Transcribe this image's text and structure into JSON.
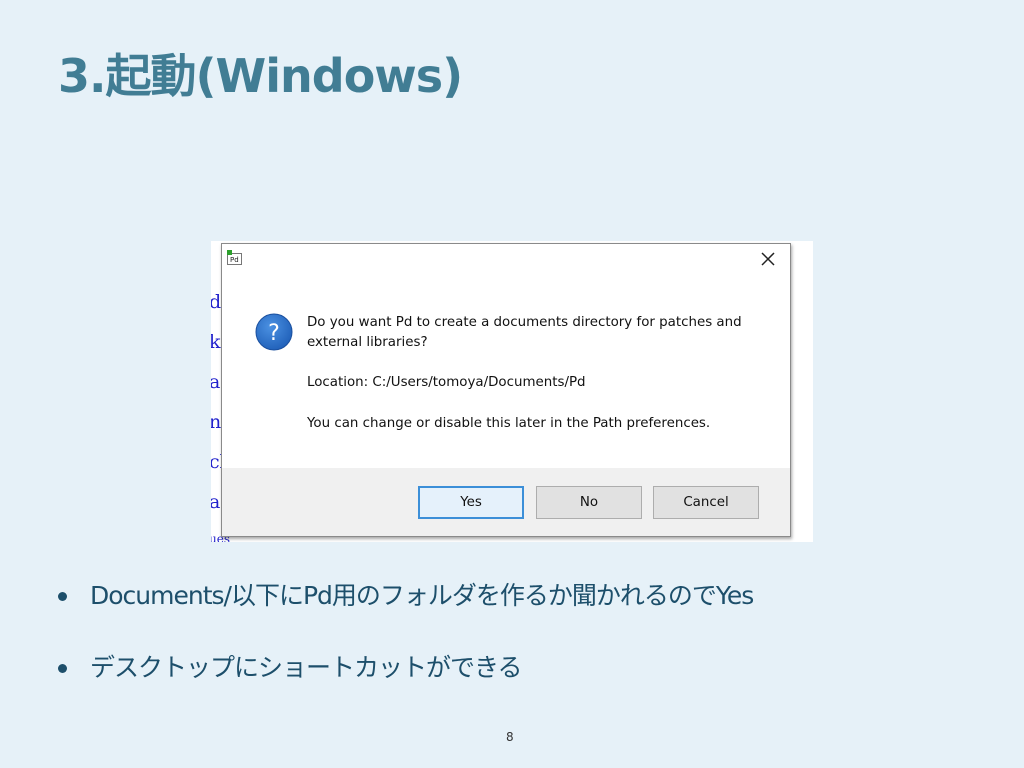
{
  "slide": {
    "title": "3.起動(Windows)",
    "page_number": "8"
  },
  "screenshot": {
    "background_fragments": [
      "de",
      "ke",
      "ar",
      "nc",
      "cl",
      "ar",
      "ues"
    ],
    "dialog": {
      "app_icon_label": "Pd",
      "close_label": "✕",
      "icon": "question-icon",
      "message_lines": [
        "Do you want Pd to create a documents directory for patches and",
        "external libraries?"
      ],
      "location_line": "Location: C:/Users/tomoya/Documents/Pd",
      "note_line": "You can change or disable this later in the Path preferences.",
      "buttons": {
        "yes": "Yes",
        "no": "No",
        "cancel": "Cancel"
      }
    }
  },
  "bullets": [
    "Documents/以下にPd用のフォルダを作るか聞かれるのでYes",
    "デスクトップにショートカットができる"
  ],
  "colors": {
    "background": "#e6f1f8",
    "title": "#417d94",
    "bullet_text": "#1d4f6b",
    "question_icon": "#2a6fc9",
    "yes_border": "#3c8fd8"
  }
}
